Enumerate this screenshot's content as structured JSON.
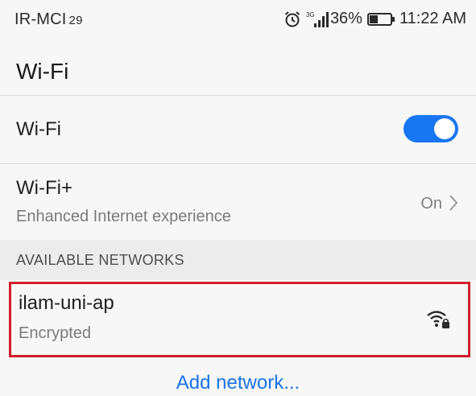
{
  "status_bar": {
    "carrier": "IR-MCI",
    "carrier_suffix": "29",
    "network_type": "3G",
    "battery": "36%",
    "time": "11:22 AM",
    "icons": [
      "alarm-icon",
      "signal-icon",
      "battery-icon"
    ]
  },
  "header": {
    "title": "Wi-Fi"
  },
  "wifi_row": {
    "label": "Wi-Fi",
    "enabled": true
  },
  "wifi_plus_row": {
    "label": "Wi-Fi+",
    "subtitle": "Enhanced Internet experience",
    "value": "On"
  },
  "section": {
    "available_networks": "AVAILABLE NETWORKS"
  },
  "networks": [
    {
      "name": "ilam-uni-ap",
      "security": "Encrypted",
      "signal_icon": "wifi-lock-icon"
    }
  ],
  "actions": {
    "add_network": "Add network..."
  },
  "colors": {
    "accent": "#1976f3",
    "link": "#1a73e8",
    "highlight_border": "#d21f2c",
    "background": "#f7f7f7",
    "section_background": "#ececec"
  }
}
